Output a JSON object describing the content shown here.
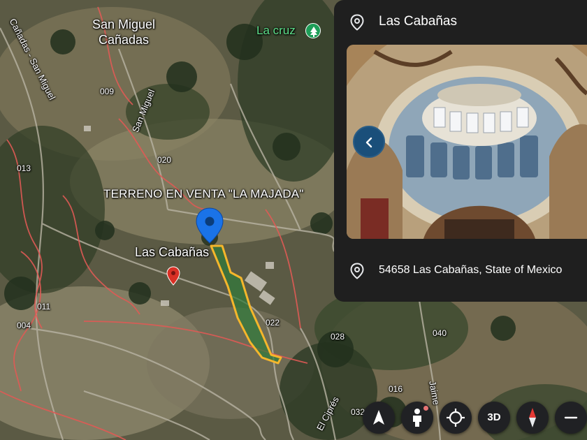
{
  "map": {
    "property_label": "TERRENO EN VENTA \"LA MAJADA\"",
    "towns": {
      "san_miguel": "San Miguel\nCañadas",
      "las_cabanas": "Las Cabañas"
    },
    "poi": {
      "la_cruz": "La cruz",
      "la_cruz_icon": "tree-icon"
    },
    "roads": {
      "canadas_san_miguel": "Cañadas - San Miguel",
      "san_miguel": "San Miguel",
      "el_cipres": "El Ciprés",
      "jaime": "Jaime"
    },
    "parcels": [
      "009",
      "020",
      "013",
      "011",
      "004",
      "022",
      "028",
      "040",
      "016",
      "032"
    ],
    "colors": {
      "boundary": "#e05a55",
      "property_outline": "#f5b62b",
      "property_fill": "#2f7a3a",
      "pin_blue": "#1a73e8",
      "pin_red": "#d93025"
    }
  },
  "panel": {
    "title": "Las Cabañas",
    "title_icon": "location-pin-icon",
    "back_icon": "chevron-left-icon",
    "address": "54658 Las Cabañas, State of Mexico",
    "address_icon": "location-pin-icon"
  },
  "controls": {
    "navigate_icon": "navigation-arrow-icon",
    "pegman_icon": "pegman-icon",
    "my_location_icon": "my-location-icon",
    "view_3d": "3D",
    "compass_icon": "compass-icon",
    "zoom_out_icon": "minus-icon"
  }
}
